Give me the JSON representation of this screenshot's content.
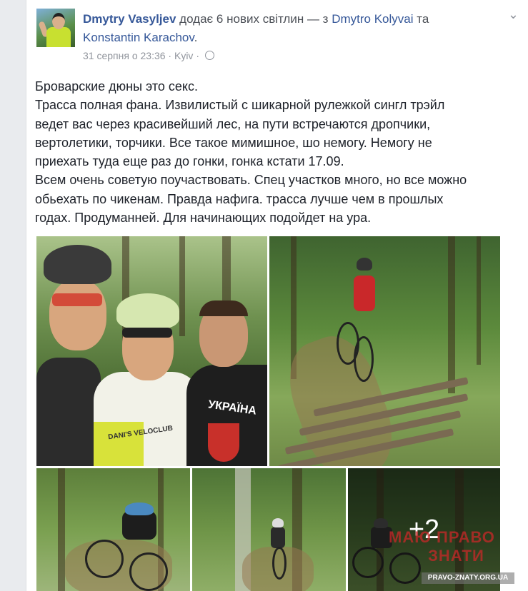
{
  "post": {
    "author": "Dmytry Vasyljev",
    "action": "додає 6 нових світлин — з",
    "tagged1": "Dmytro Kolyvai",
    "conj": "та",
    "tagged2": "Konstantin Karachov",
    "after_tagged2": ".",
    "date": "31 серпня о 23:36",
    "dot": "·",
    "location": "Kyiv",
    "chevron_icon": "chevron-down-icon",
    "privacy_icon": "globe-icon",
    "text_lines": [
      "Броварские дюны это секс.",
      "Трасса полная фана. Извилистый с шикарной рулежкой сингл трэйл",
      "ведет вас через красивейший лес, на пути встречаются дропчики,",
      "вертолетики, торчики. Все такое мимишное, шо немогу. Немогу не",
      "приехать туда еще раз до гонки, гонка кстати 17.09.",
      "Всем очень советую поучаствовать. Спец участков много, но все можно",
      "обьехать по чикенам. Правда нафига. трасса лучше чем в прошлых",
      "годах. Продуманней. Для начинающих подойдет на ура."
    ]
  },
  "photos": {
    "more_count": "+2",
    "shirt_text_ukraine": "УКРАЇНА",
    "shirt_text_dani": "DANI'S VELOCLUB"
  },
  "watermark": {
    "line1": "МАЮ ПРАВО",
    "line2": "ЗНАТИ",
    "url": "PRAVO-ZNATY.ORG.UA"
  }
}
